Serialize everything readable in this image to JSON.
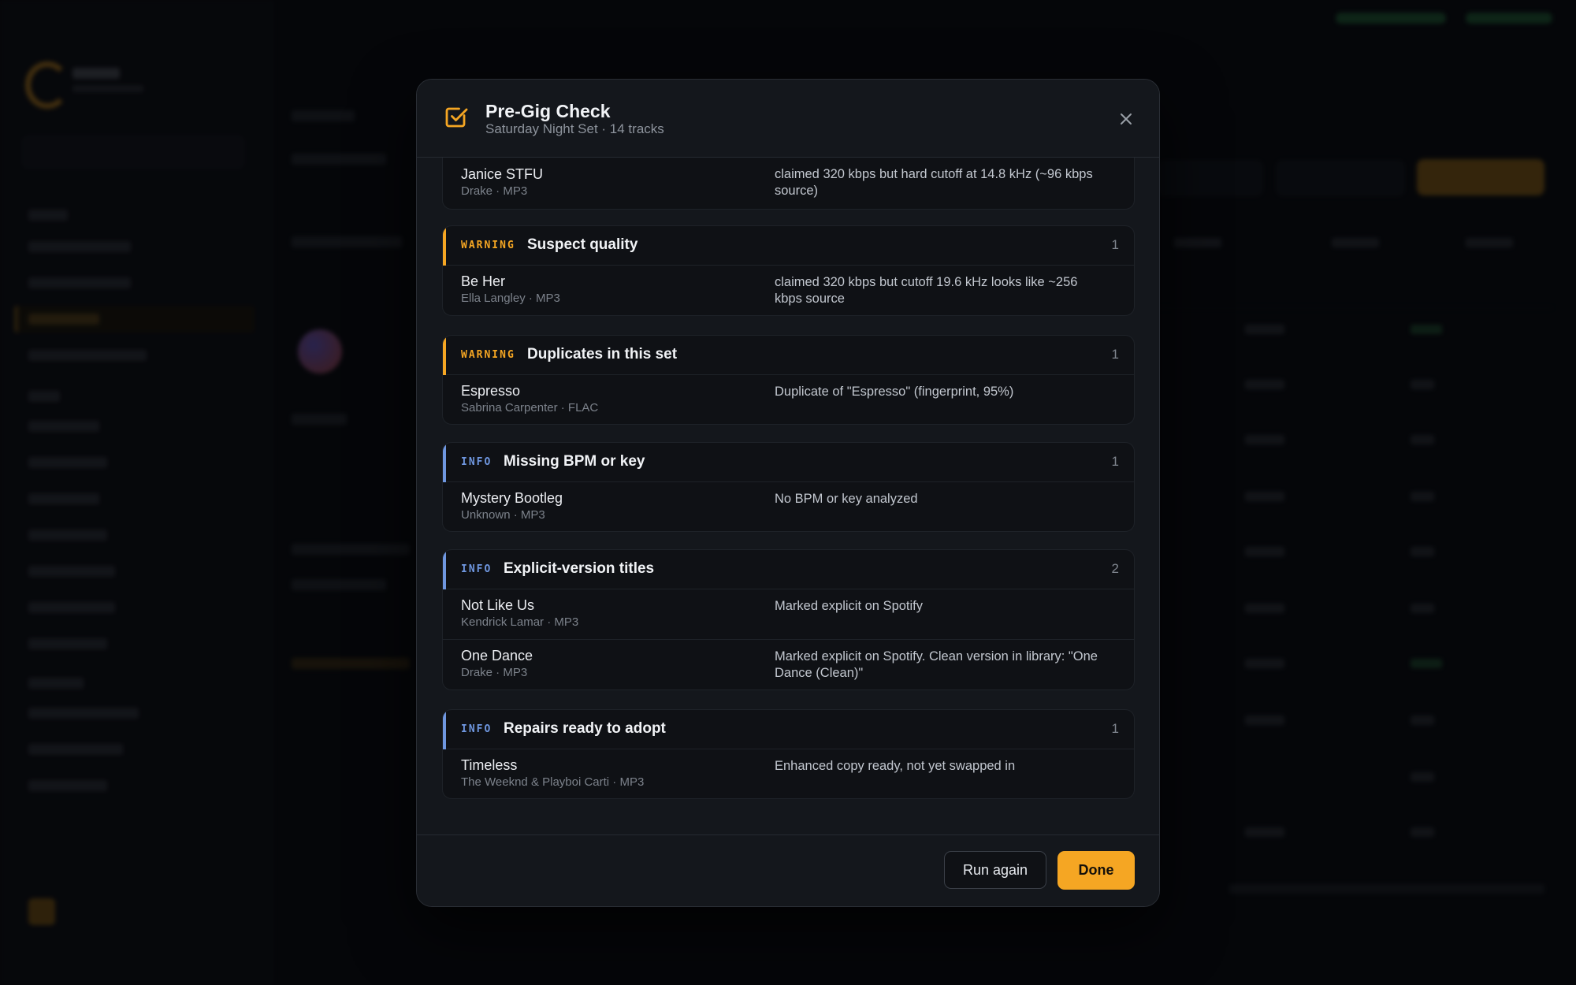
{
  "modal": {
    "title": "Pre-Gig Check",
    "subtitle": "Saturday Night Set · 14 tracks",
    "colors": {
      "warning": "#f5a623",
      "info": "#6f97e0",
      "primary_button": "#f5a623"
    },
    "partial_group": {
      "tracks": [
        {
          "name": "Janice STFU",
          "meta": "Drake · MP3",
          "note": "claimed 320 kbps but hard cutoff at 14.8 kHz (~96 kbps source)"
        }
      ]
    },
    "groups": [
      {
        "severity": "WARNING",
        "title": "Suspect quality",
        "count": "1",
        "tracks": [
          {
            "name": "Be Her",
            "meta": "Ella Langley · MP3",
            "note": "claimed 320 kbps but cutoff 19.6 kHz looks like ~256 kbps source"
          }
        ]
      },
      {
        "severity": "WARNING",
        "title": "Duplicates in this set",
        "count": "1",
        "tracks": [
          {
            "name": "Espresso",
            "meta": "Sabrina Carpenter · FLAC",
            "note": "Duplicate of \"Espresso\" (fingerprint, 95%)"
          }
        ]
      },
      {
        "severity": "INFO",
        "title": "Missing BPM or key",
        "count": "1",
        "tracks": [
          {
            "name": "Mystery Bootleg",
            "meta": "Unknown · MP3",
            "note": "No BPM or key analyzed"
          }
        ]
      },
      {
        "severity": "INFO",
        "title": "Explicit-version titles",
        "count": "2",
        "tracks": [
          {
            "name": "Not Like Us",
            "meta": "Kendrick Lamar · MP3",
            "note": "Marked explicit on Spotify"
          },
          {
            "name": "One Dance",
            "meta": "Drake · MP3",
            "note": "Marked explicit on Spotify. Clean version in library: \"One Dance (Clean)\""
          }
        ]
      },
      {
        "severity": "INFO",
        "title": "Repairs ready to adopt",
        "count": "1",
        "tracks": [
          {
            "name": "Timeless",
            "meta": "The Weeknd & Playboi Carti · MP3",
            "note": "Enhanced copy ready, not yet swapped in"
          }
        ]
      }
    ],
    "footer": {
      "run_again_label": "Run again",
      "done_label": "Done"
    }
  }
}
